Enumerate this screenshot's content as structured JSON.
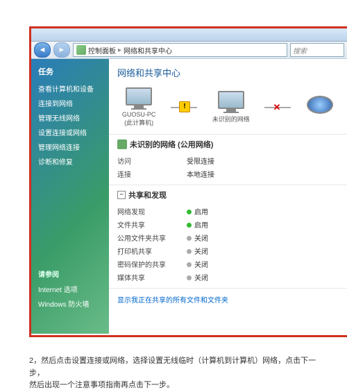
{
  "breadcrumb": {
    "a": "控制面板",
    "b": "网络和共享中心"
  },
  "search": {
    "ph": "搜索"
  },
  "sidebar": {
    "tasks_title": "任务",
    "items": [
      "查看计算机和设备",
      "连接到网络",
      "管理无线网络",
      "设置连接或网络",
      "管理网络连接",
      "诊断和修复"
    ],
    "see_title": "请参阅",
    "see": [
      "Internet 选项",
      "Windows 防火墙"
    ]
  },
  "main": {
    "title": "网络和共享中心",
    "diagram": {
      "pc": "GUOSU-PC",
      "pc_sub": "(此计算机)",
      "unk": "未识别的网络"
    },
    "unknown": {
      "title": "未识别的网络 (公用网络)",
      "rows": [
        {
          "k": "访问",
          "v": "受限连接"
        },
        {
          "k": "连接",
          "v": "本地连接"
        }
      ]
    },
    "share": {
      "title": "共享和发现",
      "rows": [
        {
          "k": "网络发现",
          "v": "启用",
          "on": true
        },
        {
          "k": "文件共享",
          "v": "启用",
          "on": true
        },
        {
          "k": "公用文件夹共享",
          "v": "关闭",
          "on": false
        },
        {
          "k": "打印机共享",
          "v": "关闭",
          "on": false
        },
        {
          "k": "密码保护的共享",
          "v": "关闭",
          "on": false
        },
        {
          "k": "媒体共享",
          "v": "关闭",
          "on": false
        }
      ]
    },
    "footer_link": "显示我正在共享的所有文件和文件夹"
  },
  "instr": {
    "l1": "2，然后点击设置连接或网络，选择设置无线临时（计算机到计算机）网络，点击下一步，",
    "l2": "然后出现一个注意事项指南再点击下一步。"
  }
}
